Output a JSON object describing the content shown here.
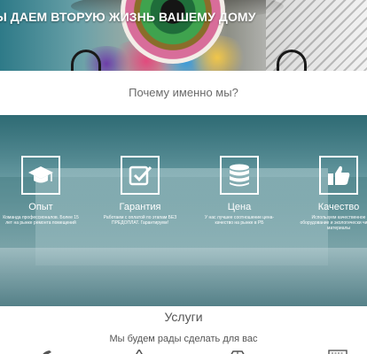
{
  "hero": {
    "title": "Ы ДАЕМ ВТОРУЮ ЖИЗНЬ ВАШЕМУ ДОМУ"
  },
  "why": {
    "title": "Почему именно мы?"
  },
  "features": [
    {
      "label": "Опыт",
      "desc": "Команда профессионалов. Более 15 лет на рынке ремонта помещений",
      "icon": "graduation-cap-icon"
    },
    {
      "label": "Гарантия",
      "desc": "Работаем с оплатой по этапам БЕЗ ПРЕДОПЛАТ. Гарантируем!",
      "icon": "checkbox-icon"
    },
    {
      "label": "Цена",
      "desc": "У нас лучшее соотношение цена-качество на рынке в РБ",
      "icon": "coins-stack-icon"
    },
    {
      "label": "Качество",
      "desc": "Используем качественное оборудование и экологически чистые материалы",
      "icon": "thumbs-up-icon"
    }
  ],
  "services": {
    "title": "Услуги",
    "subtitle": "Мы будем рады сделать для вас",
    "icons": [
      "brush-icon",
      "cone-icon",
      "brick-icon",
      "keyboard-icon"
    ]
  },
  "colors": {
    "overlay": "#3e7a82",
    "heading_text": "#6a6a6a"
  }
}
